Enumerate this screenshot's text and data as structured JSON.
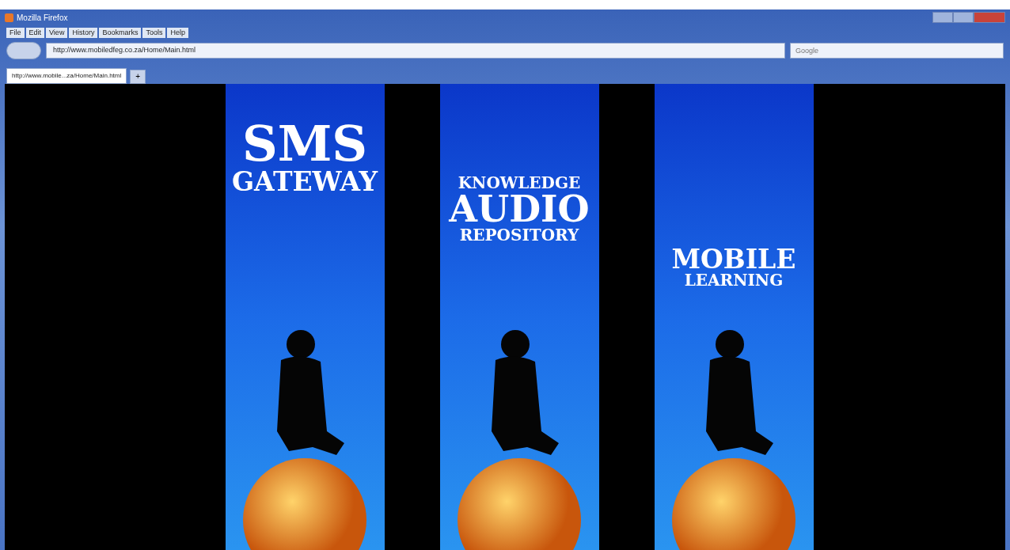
{
  "window": {
    "title": "Mozilla Firefox"
  },
  "menu": [
    "File",
    "Edit",
    "View",
    "History",
    "Bookmarks",
    "Tools",
    "Help"
  ],
  "address_bar": {
    "value": "http://www.mobiledfeg.co.za/Home/Main.html"
  },
  "search": {
    "placeholder": "Google"
  },
  "tabs": [
    {
      "label": "http://www.mobile...za/Home/Main.html",
      "selected": true
    }
  ],
  "new_tab": "+",
  "banners": [
    {
      "lines": [
        "SMS",
        "GATEWAY"
      ]
    },
    {
      "lines": [
        "KNOWLEDGE",
        "AUDIO",
        "REPOSITORY"
      ]
    },
    {
      "lines": [
        "MOBILE",
        "LEARNING"
      ]
    }
  ]
}
